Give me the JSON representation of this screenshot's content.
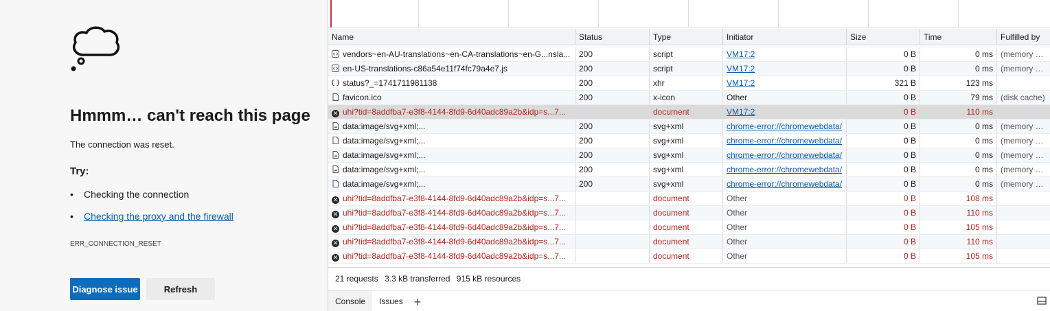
{
  "error_page": {
    "title": "Hmmm… can't reach this page",
    "message": "The connection was reset.",
    "try_label": "Try:",
    "suggestions": [
      {
        "bullet": "•",
        "text": "Checking the connection"
      },
      {
        "bullet": "•",
        "text": "Checking the proxy and the firewall"
      }
    ],
    "error_code": "ERR_CONNECTION_RESET",
    "diagnose_label": "Diagnose issue",
    "refresh_label": "Refresh",
    "icon": "thought-cloud-icon"
  },
  "network": {
    "columns": [
      "Name",
      "Status",
      "Type",
      "Initiator",
      "Size",
      "Time",
      "Fulfilled by"
    ],
    "rows": [
      {
        "icon": "script-icon",
        "name": "vendors~en-AU-translations~en-CA-translations~en-G...nsla...",
        "status": "200",
        "type": "script",
        "initiator": "VM17:2",
        "initiator_link": true,
        "size": "0 B",
        "time": "0 ms",
        "fulfilled": "(memory cache)",
        "error": false
      },
      {
        "icon": "script-icon",
        "name": "en-US-translations-c86a54e11f74fc79a4e7.js",
        "status": "200",
        "type": "script",
        "initiator": "VM17:2",
        "initiator_link": true,
        "size": "0 B",
        "time": "0 ms",
        "fulfilled": "(memory cache)",
        "error": false
      },
      {
        "icon": "xhr-icon",
        "name": "status?_=1741711981138",
        "status": "200",
        "type": "xhr",
        "initiator": "VM17:2",
        "initiator_link": true,
        "size": "321 B",
        "time": "123 ms",
        "fulfilled": "",
        "error": false
      },
      {
        "icon": "file-icon",
        "name": "favicon.ico",
        "status": "200",
        "type": "x-icon",
        "initiator": "Other",
        "initiator_link": false,
        "size": "0 B",
        "time": "79 ms",
        "fulfilled": "(disk cache)",
        "error": false
      },
      {
        "icon": "error-icon",
        "name": "uhi?tid=8addfba7-e3f8-4144-8fd9-6d40adc89a2b&idp=s...7...",
        "status": "",
        "type": "document",
        "initiator": "VM17:2",
        "initiator_link": true,
        "size": "0 B",
        "time": "110 ms",
        "fulfilled": "",
        "error": true,
        "selected": true
      },
      {
        "icon": "image-icon",
        "name": "data:image/svg+xml;...",
        "status": "200",
        "type": "svg+xml",
        "initiator": "chrome-error://chromewebdata/",
        "initiator_link": true,
        "size": "0 B",
        "time": "0 ms",
        "fulfilled": "(memory cache)",
        "error": false
      },
      {
        "icon": "file-icon",
        "name": "data:image/svg+xml;...",
        "status": "200",
        "type": "svg+xml",
        "initiator": "chrome-error://chromewebdata/",
        "initiator_link": true,
        "size": "0 B",
        "time": "0 ms",
        "fulfilled": "(memory cache)",
        "error": false
      },
      {
        "icon": "image-icon",
        "name": "data:image/svg+xml;...",
        "status": "200",
        "type": "svg+xml",
        "initiator": "chrome-error://chromewebdata/",
        "initiator_link": true,
        "size": "0 B",
        "time": "0 ms",
        "fulfilled": "(memory cache)",
        "error": false
      },
      {
        "icon": "image-icon",
        "name": "data:image/svg+xml;...",
        "status": "200",
        "type": "svg+xml",
        "initiator": "chrome-error://chromewebdata/",
        "initiator_link": true,
        "size": "0 B",
        "time": "0 ms",
        "fulfilled": "(memory cache)",
        "error": false
      },
      {
        "icon": "file-icon",
        "name": "data:image/svg+xml;...",
        "status": "200",
        "type": "svg+xml",
        "initiator": "chrome-error://chromewebdata/",
        "initiator_link": true,
        "size": "0 B",
        "time": "0 ms",
        "fulfilled": "(memory cache)",
        "error": false
      },
      {
        "icon": "error-icon",
        "name": "uhi?tid=8addfba7-e3f8-4144-8fd9-6d40adc89a2b&idp=s...7...",
        "status": "",
        "type": "document",
        "initiator": "Other",
        "initiator_link": false,
        "size": "0 B",
        "time": "108 ms",
        "fulfilled": "",
        "error": true
      },
      {
        "icon": "error-icon",
        "name": "uhi?tid=8addfba7-e3f8-4144-8fd9-6d40adc89a2b&idp=s...7...",
        "status": "",
        "type": "document",
        "initiator": "Other",
        "initiator_link": false,
        "size": "0 B",
        "time": "110 ms",
        "fulfilled": "",
        "error": true
      },
      {
        "icon": "error-icon",
        "name": "uhi?tid=8addfba7-e3f8-4144-8fd9-6d40adc89a2b&idp=s...7...",
        "status": "",
        "type": "document",
        "initiator": "Other",
        "initiator_link": false,
        "size": "0 B",
        "time": "105 ms",
        "fulfilled": "",
        "error": true
      },
      {
        "icon": "error-icon",
        "name": "uhi?tid=8addfba7-e3f8-4144-8fd9-6d40adc89a2b&idp=s...7...",
        "status": "",
        "type": "document",
        "initiator": "Other",
        "initiator_link": false,
        "size": "0 B",
        "time": "110 ms",
        "fulfilled": "",
        "error": true
      },
      {
        "icon": "error-icon",
        "name": "uhi?tid=8addfba7-e3f8-4144-8fd9-6d40adc89a2b&idp=s...7...",
        "status": "",
        "type": "document",
        "initiator": "Other",
        "initiator_link": false,
        "size": "0 B",
        "time": "105 ms",
        "fulfilled": "",
        "error": true
      }
    ],
    "summary": {
      "requests": "21 requests",
      "transferred": "3.3 kB transferred",
      "resources": "915 kB resources"
    }
  },
  "drawer": {
    "tabs": [
      "Console",
      "Issues"
    ],
    "add_tab": "+"
  },
  "colors": {
    "primary_button": "#0f6cbd",
    "error_text": "#b3261e",
    "link": "#0b5cad"
  }
}
